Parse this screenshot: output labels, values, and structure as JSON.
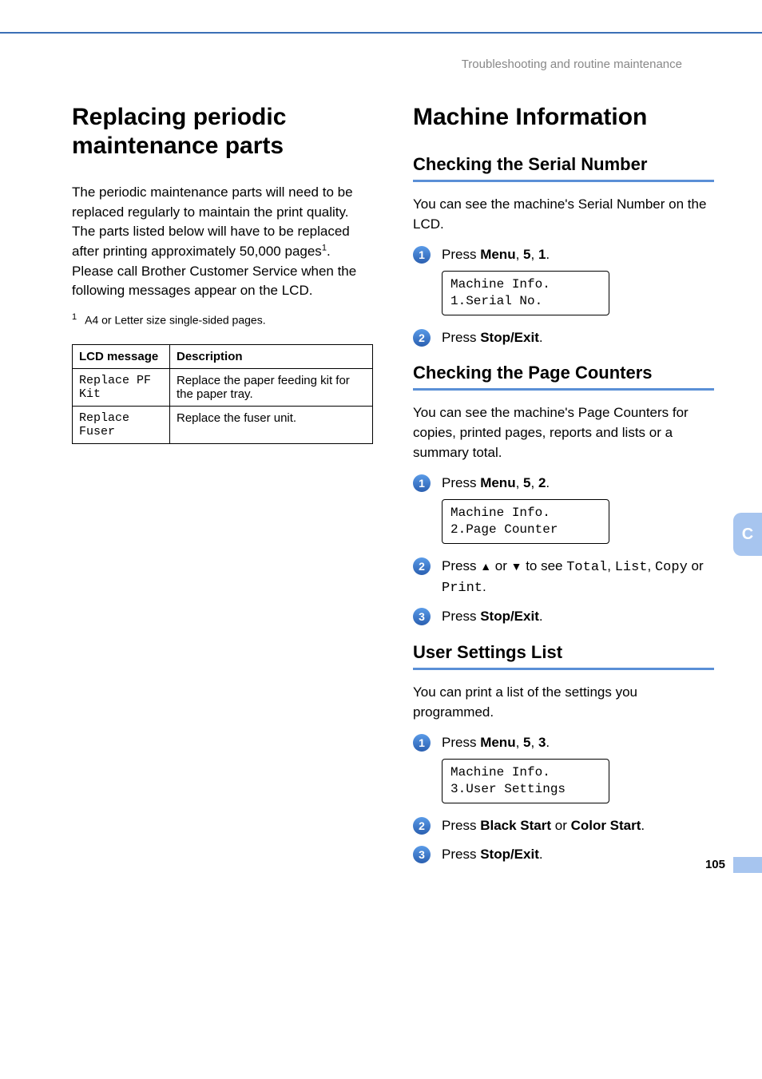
{
  "breadcrumb": "Troubleshooting and routine maintenance",
  "left": {
    "heading": "Replacing periodic maintenance parts",
    "para_a": "The periodic maintenance parts will need to be replaced regularly to maintain the print quality. The parts listed below will have to be replaced after printing approximately 50,000 pages",
    "sup1": "1",
    "para_b": ". Please call Brother Customer Service when the following messages appear on the LCD.",
    "footnote_sup": "1",
    "footnote": "A4 or Letter size single-sided pages.",
    "table": {
      "h1": "LCD message",
      "h2": "Description",
      "r1c1": "Replace PF Kit",
      "r1c2": "Replace the paper feeding kit for the paper tray.",
      "r2c1": "Replace Fuser",
      "r2c2": "Replace the fuser unit."
    }
  },
  "right": {
    "heading": "Machine Information",
    "serial": {
      "title": "Checking the Serial Number",
      "intro": "You can see the machine's Serial Number on the LCD.",
      "s1_pre": "Press ",
      "s1_b1": "Menu",
      "s1_mid1": ", ",
      "s1_b2": "5",
      "s1_mid2": ", ",
      "s1_b3": "1",
      "s1_post": ".",
      "lcd": "Machine Info.\n1.Serial No.",
      "s2_pre": "Press ",
      "s2_b": "Stop/Exit",
      "s2_post": "."
    },
    "counters": {
      "title": "Checking the Page Counters",
      "intro": "You can see the machine's Page Counters for copies, printed pages, reports and lists or a summary total.",
      "s1_pre": "Press ",
      "s1_b1": "Menu",
      "s1_mid1": ", ",
      "s1_b2": "5",
      "s1_mid2": ", ",
      "s1_b3": "2",
      "s1_post": ".",
      "lcd": "Machine Info.\n2.Page Counter",
      "s2_pre": "Press ",
      "s2_up": "▲",
      "s2_or1": " or ",
      "s2_down": "▼",
      "s2_mid": " to see ",
      "s2_m1": "Total",
      "s2_c1": ", ",
      "s2_m2": "List",
      "s2_c2": ", ",
      "s2_m3": "Copy",
      "s2_or2": " or ",
      "s2_m4": "Print",
      "s2_post": ".",
      "s3_pre": "Press ",
      "s3_b": "Stop/Exit",
      "s3_post": "."
    },
    "usersettings": {
      "title": "User Settings List",
      "intro": "You can print a list of the settings you programmed.",
      "s1_pre": "Press ",
      "s1_b1": "Menu",
      "s1_mid1": ", ",
      "s1_b2": "5",
      "s1_mid2": ", ",
      "s1_b3": "3",
      "s1_post": ".",
      "lcd": "Machine Info.\n3.User Settings",
      "s2_pre": "Press ",
      "s2_b1": "Black Start",
      "s2_or": " or ",
      "s2_b2": "Color Start",
      "s2_post": ".",
      "s3_pre": "Press ",
      "s3_b": "Stop/Exit",
      "s3_post": "."
    }
  },
  "sidetab": "C",
  "pagenum": "105",
  "badges": {
    "n1": "1",
    "n2": "2",
    "n3": "3"
  }
}
